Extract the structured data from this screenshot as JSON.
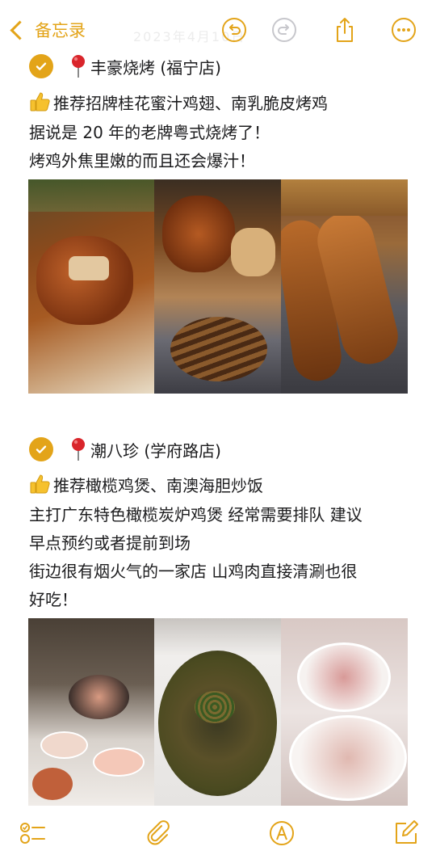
{
  "nav": {
    "back_label": "备忘录",
    "faint_date": "2023年4月10日"
  },
  "toolbar_icons": [
    "undo-icon",
    "redo-icon",
    "share-icon",
    "more-icon"
  ],
  "entries": [
    {
      "title": "丰豪烧烤 (福宁店)",
      "lines": [
        "推荐招牌桂花蜜汁鸡翅、南乳脆皮烤鸡",
        "据说是 20 年的老牌粤式烧烤了！",
        "烤鸡外焦里嫩的而且还会爆汁！"
      ],
      "photos": [
        "roast-chicken-photo",
        "roast-chicken-skewers-photo",
        "grilled-wings-photo"
      ]
    },
    {
      "title": "潮八珍 (学府路店)",
      "lines": [
        "推荐橄榄鸡煲、南澳海胆炒饭",
        "主打广东特色橄榄炭炉鸡煲 经常需要排队 建议",
        "早点预约或者提前到场",
        "街边很有烟火气的一家店 山鸡肉直接清涮也很",
        "好吃！"
      ],
      "photos": [
        "hotpot-table-photo",
        "sea-urchin-fried-rice-photo",
        "raw-chicken-plates-photo"
      ]
    }
  ],
  "bottom_icons": [
    "checklist-icon",
    "attachment-icon",
    "markup-icon",
    "compose-icon"
  ],
  "colors": {
    "accent": "#e3a419",
    "text": "#1c1c1e"
  }
}
